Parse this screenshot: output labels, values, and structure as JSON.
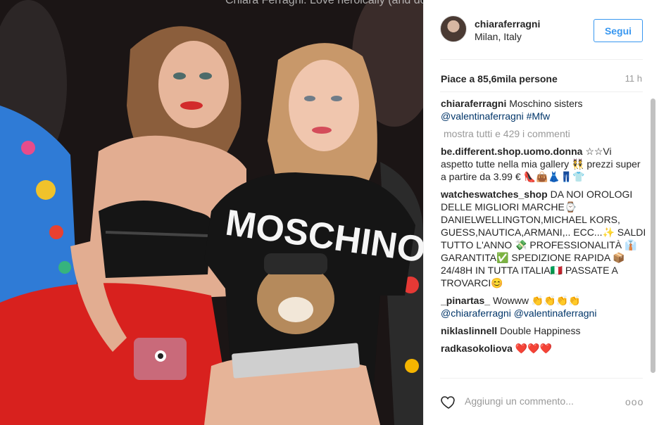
{
  "photo": {
    "overlay_text": "Chiara Ferragni. Love heroically (and don't forget to stop along the way to take",
    "shirt_text": "MOSCHINO"
  },
  "header": {
    "username": "chiaraferragni",
    "location": "Milan, Italy",
    "follow_label": "Segui"
  },
  "stats": {
    "likes": "Piace a 85,6mila persone",
    "time": "11 h"
  },
  "comments": {
    "caption": {
      "user": "chiaraferragni",
      "text": "Moschino sisters",
      "mentions": "@valentinaferragni #Mfw"
    },
    "view_all": "mostra tutti e 429 i commenti",
    "items": [
      {
        "user": "be.different.shop.uomo.donna",
        "text": "☆☆Vi aspetto tutte nella mia gallery 👯 prezzi super a partire da 3.99 € 👠👜👗👖👕"
      },
      {
        "user": "watcheswatches_shop",
        "text": "DA NOI OROLOGI DELLE MIGLIORI MARCHE⌚DANIELWELLINGTON,MICHAEL KORS, GUESS,NAUTICA,ARMANI,.. ECC...✨ SALDI TUTTO L'ANNO 💸 PROFESSIONALITÀ 👔GARANTITA✅ SPEDIZIONE RAPIDA 📦24/48H IN TUTTA ITALIA🇮🇹 PASSATE A TROVARCI😊"
      },
      {
        "user": "_pinartas_",
        "text": "Wowww 👏👏👏👏",
        "mentions": "@chiaraferragni @valentinaferragni"
      },
      {
        "user": "niklaslinnell",
        "text": "Double Happiness"
      },
      {
        "user": "radkasokoliova",
        "text": "❤️❤️❤️"
      }
    ]
  },
  "footer": {
    "comment_placeholder": "Aggiungi un commento...",
    "more_label": "ooo"
  },
  "icons": {
    "heart": "heart-outline-icon",
    "more": "more-options-icon"
  },
  "colors": {
    "accent": "#3897f0",
    "text": "#262626",
    "muted": "#999999",
    "link": "#003569"
  }
}
